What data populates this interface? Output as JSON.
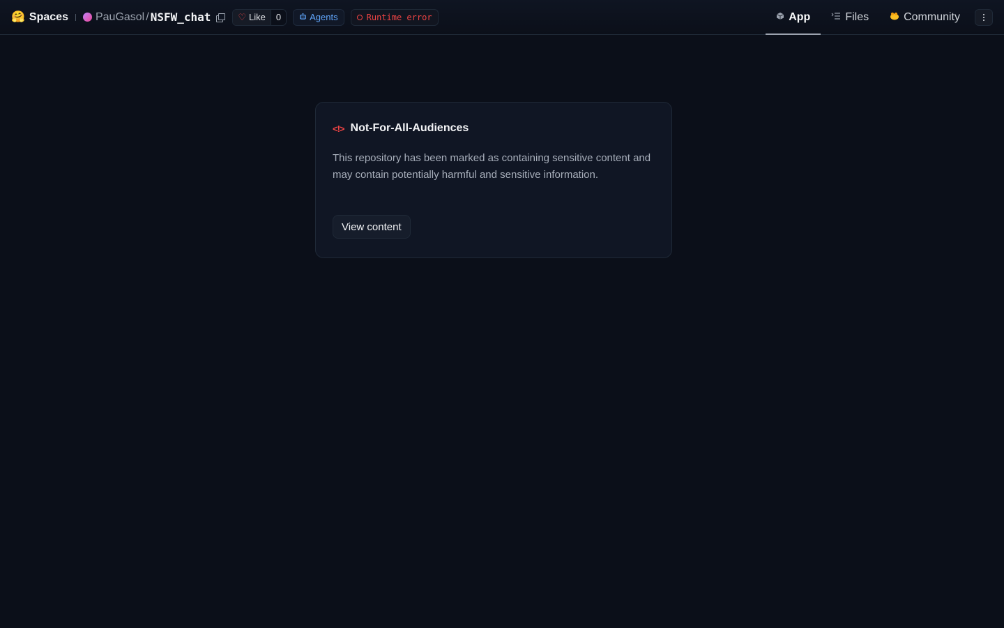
{
  "header": {
    "brand_label": "Spaces",
    "brand_emoji": "🤗",
    "owner": "PauGasol",
    "slash": "/",
    "repo_name": "NSFW_chat",
    "like_label": "Like",
    "like_count": "0",
    "agents_label": "Agents",
    "status_label": "Runtime error"
  },
  "tabs": [
    {
      "label": "App",
      "icon": "cube-icon",
      "active": true
    },
    {
      "label": "Files",
      "icon": "files-icon",
      "active": false
    },
    {
      "label": "Community",
      "icon": "community-icon",
      "active": false
    }
  ],
  "card": {
    "title": "Not-For-All-Audiences",
    "warning_glyph": "<!>",
    "description": "This repository has been marked as containing sensitive content and may contain potentially harmful and sensitive information.",
    "button_label": "View content"
  },
  "colors": {
    "background": "#0b0f19",
    "danger": "#ef4444",
    "agents_accent": "#60a5fa"
  }
}
